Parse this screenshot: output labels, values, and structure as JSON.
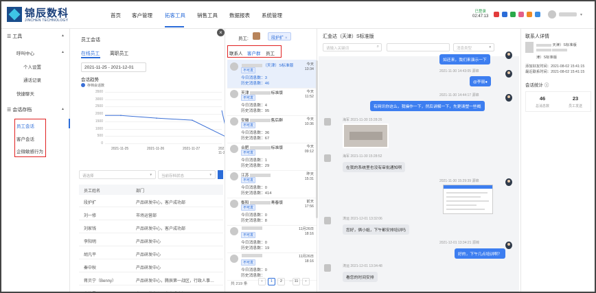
{
  "brand": {
    "name_cn": "锦辰数科",
    "name_en": "JINCHEN TECHNOLOGY"
  },
  "topnav": {
    "items": [
      "首页",
      "客户管理",
      "拓客工具",
      "销售工具",
      "数据报表",
      "系统管理"
    ],
    "active": "拓客工具",
    "clock_status": "已登录",
    "clock_time": "02:47:13"
  },
  "sidebar": {
    "tools_label": "工具",
    "call_center_label": "呼叫中心",
    "personal_settings": "个人设置",
    "call_records": "通话记录",
    "quick_chat": "快捷聊天",
    "session_archive": "会话存档",
    "employee_sessions": "员工会话",
    "customer_sessions": "客户会话",
    "enterprise_sensitive": "企微敏感行为"
  },
  "employee_panel": {
    "title": "员工会话",
    "tab_active": "在线员工",
    "tab_other": "离职员工",
    "date_range": "2021-11-25 - 2021-12-01",
    "trend_title": "会话趋势",
    "select_placeholder": "请选择",
    "employee_select_placeholder": "当前存档状态",
    "table_headers": [
      "员工姓名",
      "部门"
    ],
    "rows": [
      {
        "name": "段护扩",
        "dept": "产品研发中心，客户成功部"
      },
      {
        "name": "刘一修",
        "dept": "市场运营部"
      },
      {
        "name": "刘家钱",
        "dept": "产品研发中心，客户成功部"
      },
      {
        "name": "李阳明",
        "dept": "产品研发中心"
      },
      {
        "name": "胡凡平",
        "dept": "产品研发中心"
      },
      {
        "name": "秦中秋",
        "dept": "产品研发中心"
      },
      {
        "name": "蒋贝宁（Benny）",
        "dept": "产品研发中心，腾辰第一战区，行政人事…"
      },
      {
        "name": "李佳星",
        "dept": "产品研发中心，客户成功部"
      }
    ]
  },
  "chart_data": {
    "type": "line",
    "legend": "存档会话数",
    "categories": [
      "2021-11-25",
      "2021-11-26",
      "2021-11-27",
      "2021-11-28"
    ],
    "series": [
      {
        "name": "存档会话数",
        "values": [
          1900,
          1720,
          1580,
          380
        ]
      }
    ],
    "ylim": [
      0,
      3500
    ],
    "yticks": [
      0,
      500,
      1000,
      1500,
      2000,
      2500,
      3000,
      3500
    ],
    "color": "#3a6fd6"
  },
  "conv_panel": {
    "staff_label": "员工:",
    "staff_selected": "段护扩",
    "tabs": [
      "联系人",
      "客户群",
      "员工"
    ],
    "active_tab": "客户群",
    "today_prefix": "今日消息数：",
    "history_prefix": "历史消息数：",
    "items": [
      {
        "name_prefix": "",
        "name_suffix": "（天津）S标准版",
        "badge": "不可发",
        "time_day": "今天",
        "time": "13:34",
        "today": "3",
        "history": "46",
        "selected": true
      },
      {
        "name_prefix": "天津",
        "name_suffix": "标准版",
        "badge": "不可发",
        "time_day": "今天",
        "time": "11:52",
        "today": "4",
        "history": "95",
        "selected": false
      },
      {
        "name_prefix": "安徽",
        "name_suffix": "售后群",
        "badge": "不可发",
        "time_day": "今天",
        "time": "10:36",
        "today": "36",
        "history": "67",
        "selected": false
      },
      {
        "name_prefix": "合肥",
        "name_suffix": "标准版",
        "badge": "不可发",
        "time_day": "今天",
        "time": "09:12",
        "today": "1",
        "history": "29",
        "selected": false
      },
      {
        "name_prefix": "江苏",
        "name_suffix": "",
        "badge": "不可发",
        "time_day": "昨天",
        "time": "15:31",
        "today": "0",
        "history": "414",
        "selected": false
      },
      {
        "name_prefix": "衡阳",
        "name_suffix": "青春版",
        "badge": "不可发",
        "time_day": "前天",
        "time": "17:56",
        "today": "0",
        "history": "8",
        "selected": false
      },
      {
        "name_prefix": "",
        "name_suffix": "",
        "badge": "不可发",
        "time_day": "11月26日",
        "time": "18:16",
        "today": "0",
        "history": "19",
        "selected": false
      },
      {
        "name_prefix": "",
        "name_suffix": "",
        "badge": "不可发",
        "time_day": "11月26日",
        "time": "18:16",
        "today": "0",
        "history": "",
        "selected": false
      }
    ],
    "pager_total": "共 219 条",
    "pages": [
      "1",
      "2",
      "...",
      "11"
    ]
  },
  "chat": {
    "title": "汇金达（天津）S标准版",
    "search_placeholder": "请输入关键词",
    "date_placeholder": "",
    "type_placeholder": "消息类型",
    "messages": [
      {
        "text": "如还来，我们来演示一下",
        "dir": "out"
      },
      {
        "meta": "2021-11-30 14:43:05  源锦",
        "text": "@李丽●",
        "dir": "out"
      },
      {
        "meta": "2021-11-30 14:44:17  源锦",
        "text": "有网讯你这么，我操作一下，然后讲解一下，先更请塑一些概",
        "dir": "out"
      },
      {
        "meta": "海军  2021-11-30 15:28:26",
        "dir": "in"
      },
      {
        "meta": "海军  2021-11-30 15:28:52",
        "text": "在我的系统里也没有审批通知啊",
        "dir": "in"
      },
      {
        "meta": "2021-11-30 15:29:39  源锦",
        "dir": "out"
      },
      {
        "meta": "涛运  2021-12-01 13:32:06",
        "text": "您好，俩小姐，下午都安排培训吗",
        "dir": "in"
      },
      {
        "meta": "2021-12-01 13:34:21  源锦",
        "text": "好的，下午几点培训啊？",
        "dir": "out"
      },
      {
        "meta": "涛运  2021-12-01 13:34:48",
        "text": "看您的时间安排",
        "dir": "in"
      }
    ]
  },
  "details": {
    "title": "联系人详情",
    "name_suffix": "天津）S标准版",
    "sub1": "津）S标准版",
    "created": "添加好友时间：2021-08-02 15:41:15",
    "recent": "最近联系时间：2021-08-02 15:41:15",
    "stats_title": "会话统计",
    "total_msgs": "46",
    "total_label": "总消息数",
    "staff_msgs": "23",
    "staff_label": "员工发送"
  }
}
